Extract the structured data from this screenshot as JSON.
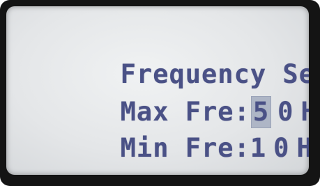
{
  "screen": {
    "title": "Frequency Set:",
    "max_row": {
      "label": "Max Fre:",
      "digit_1": "5",
      "digit_2": "0",
      "unit": "Hz"
    },
    "min_row": {
      "label": "Min Fre:",
      "digit_1": "1",
      "digit_2": "0",
      "unit": "Hz"
    }
  },
  "colors": {
    "text": "#4a5186",
    "background": "#e4e6e8",
    "cursor": "#aeb6c6",
    "bezel": "#141414"
  }
}
